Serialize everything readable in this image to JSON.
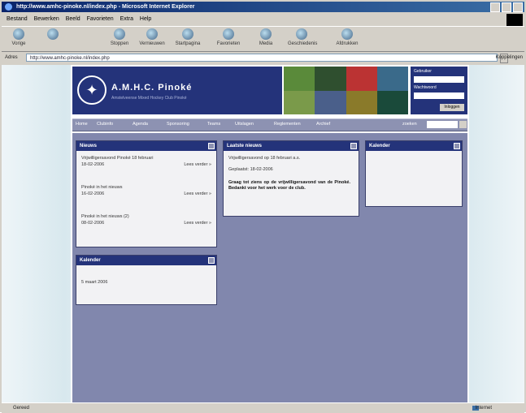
{
  "window": {
    "title": "http://www.amhc-pinoke.nl/index.php - Microsoft Internet Explorer"
  },
  "menu": [
    "Bestand",
    "Bewerken",
    "Beeld",
    "Favorieten",
    "Extra",
    "Help"
  ],
  "toolbar": {
    "buttons": [
      {
        "label": "Vorige",
        "icon": "back-icon"
      },
      {
        "label": "",
        "icon": "forward-icon"
      },
      {
        "label": "Stoppen",
        "icon": "stop-icon"
      },
      {
        "label": "Vernieuwen",
        "icon": "refresh-icon"
      },
      {
        "label": "Startpagina",
        "icon": "home-icon"
      },
      {
        "label": "Favorieten",
        "icon": "favorites-icon"
      },
      {
        "label": "Media",
        "icon": "media-icon"
      },
      {
        "label": "Geschiedenis",
        "icon": "history-icon"
      },
      {
        "label": "Afdrukken",
        "icon": "print-icon"
      }
    ]
  },
  "address": {
    "label": "Adres",
    "url": "http://www.amhc-pinoke.nl/index.php",
    "links_label": "Koppelingen"
  },
  "site": {
    "logo_title": "A.M.H.C. Pinoké",
    "logo_subtitle": "Amstelveense Mixed Hockey Club Pinoké",
    "login": {
      "user_label": "Gebruiker",
      "pass_label": "Wachtwoord",
      "button": "Inloggen"
    },
    "nav": [
      "Home",
      "Clubinfo",
      "Agenda",
      "Sponsoring",
      "Teams",
      "Uitslagen",
      "Reglementen",
      "Archief"
    ],
    "search_label": "zoeken"
  },
  "panels": {
    "nieuws": {
      "title": "Nieuws",
      "items": [
        {
          "headline": "Vrijwilligersavond Pinoké 18 februari",
          "date": "18-02-2006",
          "more": "Lees verder »"
        },
        {
          "headline": "Pinoké in het nieuws",
          "date": "16-02-2006",
          "more": "Lees verder »"
        },
        {
          "headline": "Pinoké in het nieuws (2)",
          "date": "08-02-2006",
          "more": "Lees verder »"
        }
      ]
    },
    "laatste": {
      "title": "Laatste nieuws",
      "headline": "Vrijwilligersavond op 18 februari a.s.",
      "posted": "Geplaatst: 18-02-2006",
      "body": "Graag tot ziens op de vrijwilligersavond van de Pinoké. Bedankt voor het werk voor de club."
    },
    "agenda": {
      "title": "Kalender"
    },
    "kalender": {
      "title": "Kalender",
      "entry": "5 maart 2006"
    }
  },
  "status": {
    "left": "Gereed",
    "right": "Internet"
  }
}
